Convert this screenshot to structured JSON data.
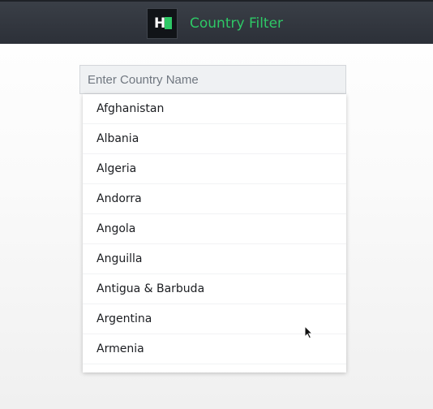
{
  "header": {
    "logo_letter": "H",
    "logo_accent_color": "#2ec866",
    "title": "Country Filter"
  },
  "search": {
    "placeholder": "Enter Country Name",
    "value": ""
  },
  "countries": [
    "Afghanistan",
    "Albania",
    "Algeria",
    "Andorra",
    "Angola",
    "Anguilla",
    "Antigua & Barbuda",
    "Argentina",
    "Armenia"
  ],
  "cursor": {
    "icon": "mouse-pointer-icon"
  }
}
